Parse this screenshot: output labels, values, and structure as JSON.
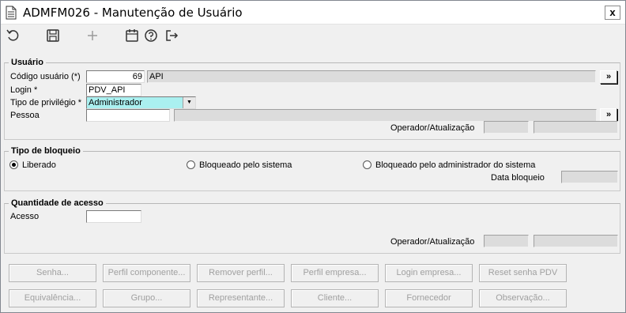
{
  "window": {
    "title": "ADMFM026 - Manutenção de Usuário",
    "close_label": "x"
  },
  "toolbar": {
    "icons": [
      "undo-icon",
      "save-icon",
      "add-icon",
      "calendar-icon",
      "help-icon",
      "exit-icon"
    ]
  },
  "usuario": {
    "legend": "Usuário",
    "codigo_label": "Código usuário (*)",
    "codigo_value": "69",
    "codigo_desc": "API",
    "login_label": "Login *",
    "login_value": "PDV_API",
    "privilegio_label": "Tipo de privilégio *",
    "privilegio_value": "Administrador",
    "pessoa_label": "Pessoa",
    "pessoa_value": "",
    "pessoa_desc": "",
    "pick_label": "»",
    "operador_label": "Operador/Atualização"
  },
  "bloqueio": {
    "legend": "Tipo de bloqueio",
    "options": [
      "Liberado",
      "Bloqueado pelo sistema",
      "Bloqueado pelo administrador do sistema"
    ],
    "selected": "Liberado",
    "data_label": "Data bloqueio"
  },
  "acesso": {
    "legend": "Quantidade de acesso",
    "acesso_label": "Acesso",
    "acesso_value": "",
    "operador_label": "Operador/Atualização"
  },
  "buttons": {
    "row1": [
      "Senha...",
      "Perfil componente...",
      "Remover perfil...",
      "Perfil empresa...",
      "Login empresa...",
      "Reset senha PDV"
    ],
    "row2": [
      "Equivalência...",
      "Grupo...",
      "Representante...",
      "Cliente...",
      "Fornecedor",
      "Observação..."
    ]
  },
  "colors": {
    "selected_field": "#aaf0f0",
    "readonly_field": "#dcdcdc",
    "disabled_text": "#a0a0a0"
  }
}
